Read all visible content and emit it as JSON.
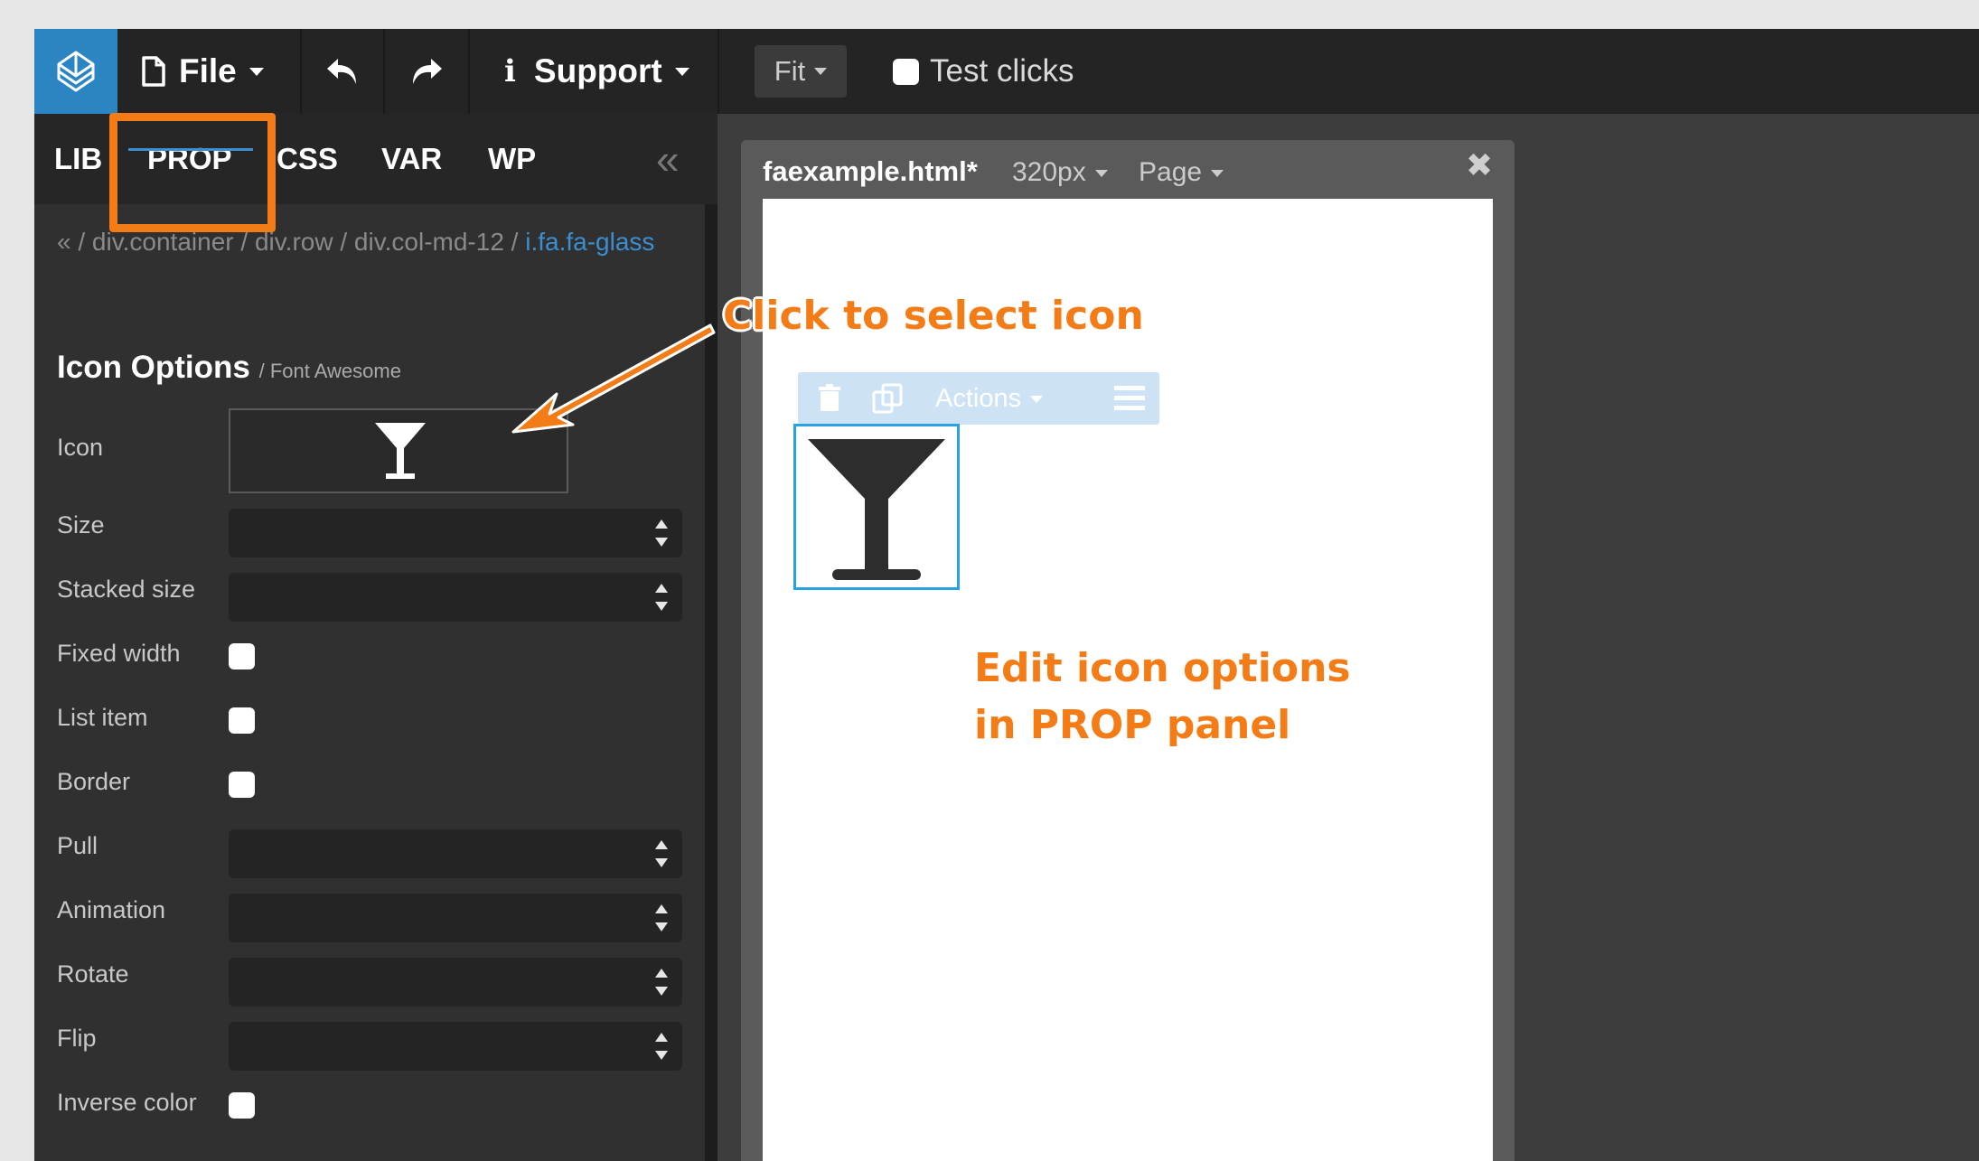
{
  "toolbar": {
    "logo_icon": "pinegrow-logo-icon",
    "file_label": "File",
    "support_label": "Support",
    "fit_label": "Fit",
    "test_clicks_label": "Test clicks"
  },
  "panel": {
    "tabs": [
      {
        "label": "LIB"
      },
      {
        "label": "PROP"
      },
      {
        "label": "CSS"
      },
      {
        "label": "VAR"
      },
      {
        "label": "WP"
      }
    ],
    "active_tab": "PROP",
    "collapse_glyph": "«",
    "breadcrumb": {
      "back": "«",
      "sep": " / ",
      "items": [
        "div.container",
        "div.row",
        "div.col-md-12",
        "i.fa.fa-glass"
      ]
    },
    "section_title": "Icon Options",
    "section_subtitle": "/ Font Awesome",
    "rows": {
      "icon": "Icon",
      "size": "Size",
      "stacked_size": "Stacked size",
      "fixed_width": "Fixed width",
      "list_item": "List item",
      "border": "Border",
      "pull": "Pull",
      "animation": "Animation",
      "rotate": "Rotate",
      "flip": "Flip",
      "inverse_color": "Inverse color"
    }
  },
  "document": {
    "title": "faexample.html*",
    "width_label": "320px",
    "page_label": "Page",
    "close_glyph": "✖",
    "element_toolbar": {
      "actions_label": "Actions"
    }
  },
  "annotations": {
    "click_to_select": "Click to select icon",
    "edit_line1": "Edit icon options",
    "edit_line2": "in PROP panel"
  },
  "colors": {
    "accent_blue": "#2a85c2",
    "highlight_orange": "#f47c16",
    "selection_blue": "#29a3e0"
  }
}
